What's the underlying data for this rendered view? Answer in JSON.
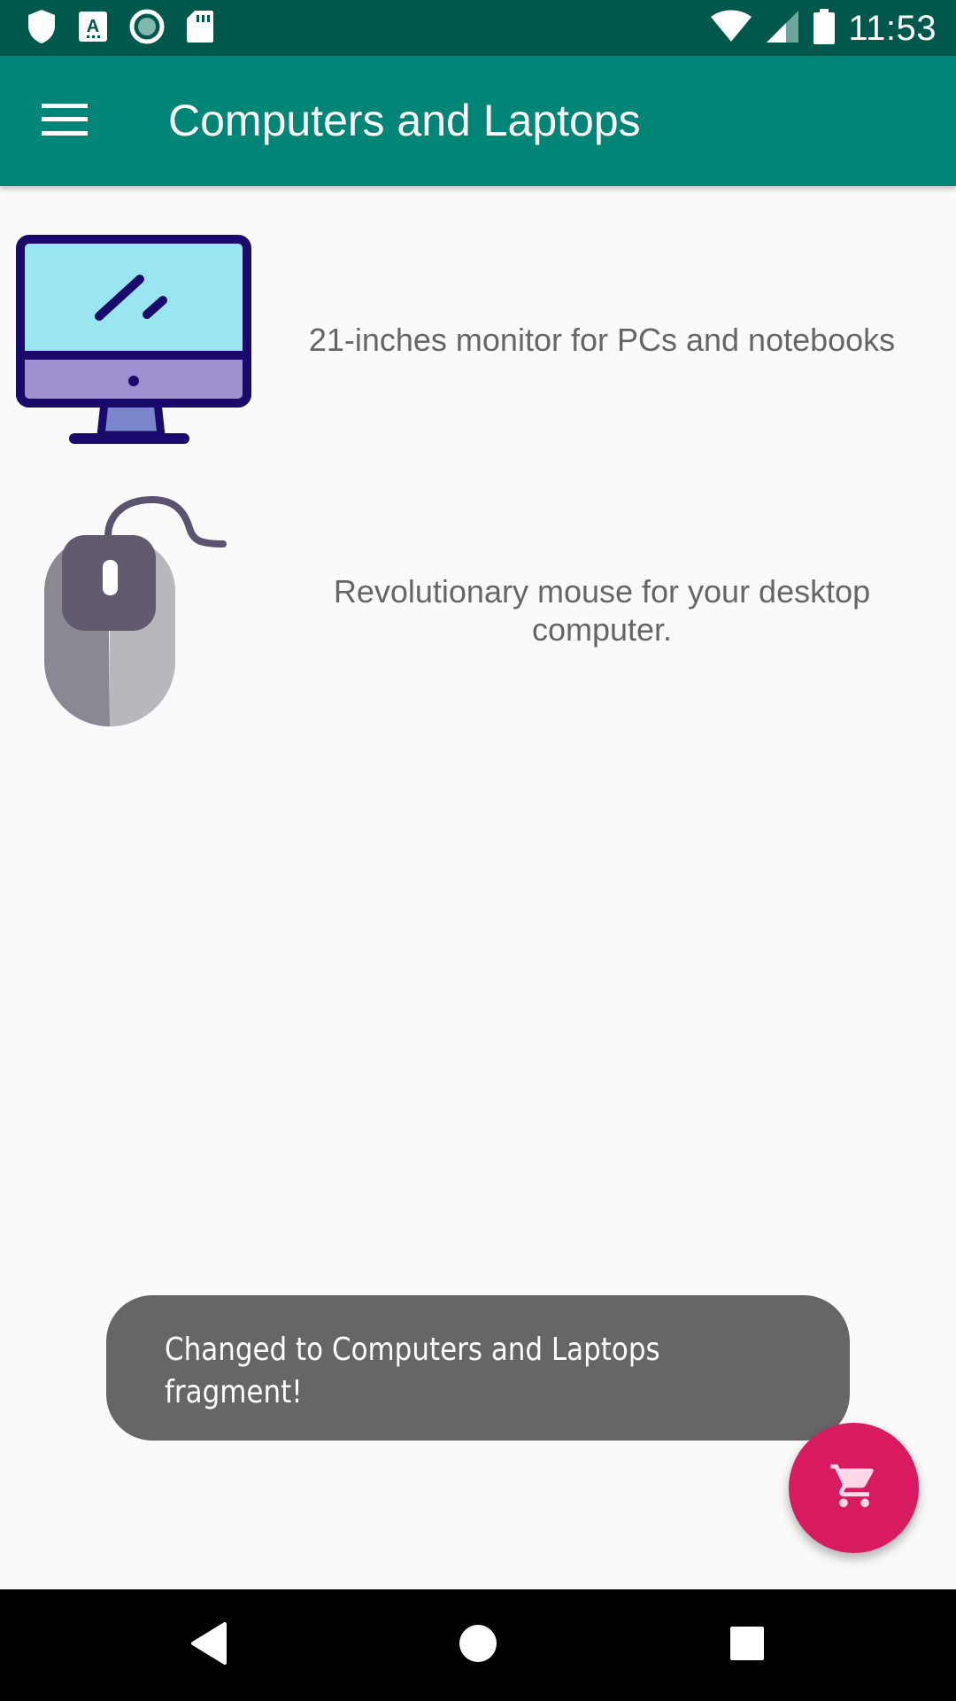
{
  "status_bar": {
    "time": "11:53",
    "left_icons": [
      "shield-icon",
      "text-a-icon",
      "circle-record-icon",
      "sd-card-icon"
    ],
    "right_icons": [
      "wifi-icon",
      "signal-icon",
      "battery-icon"
    ]
  },
  "app_bar": {
    "title": "Computers and Laptops",
    "menu_icon": "hamburger-menu-icon"
  },
  "products": [
    {
      "image_icon": "monitor-icon",
      "description": "21-inches monitor for PCs and notebooks"
    },
    {
      "image_icon": "mouse-icon",
      "description": "Revolutionary mouse for your desktop computer."
    }
  ],
  "toast": {
    "message": "Changed to Computers and Laptops fragment!"
  },
  "fab": {
    "icon": "shopping-cart-icon"
  },
  "nav_bar": {
    "buttons": [
      "back-icon",
      "home-icon",
      "recents-icon"
    ]
  },
  "colors": {
    "status_bar": "#00574b",
    "app_bar": "#008577",
    "fab": "#d81b60",
    "toast": "#666666",
    "background": "#fafafa"
  }
}
